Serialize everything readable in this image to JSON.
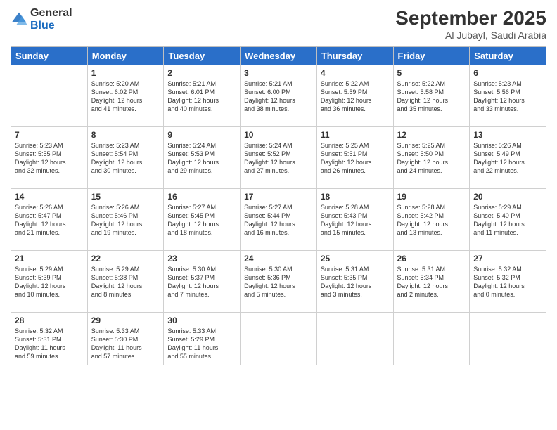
{
  "header": {
    "logo_general": "General",
    "logo_blue": "Blue",
    "month_title": "September 2025",
    "location": "Al Jubayl, Saudi Arabia"
  },
  "weekdays": [
    "Sunday",
    "Monday",
    "Tuesday",
    "Wednesday",
    "Thursday",
    "Friday",
    "Saturday"
  ],
  "weeks": [
    [
      {
        "day": "",
        "text": ""
      },
      {
        "day": "1",
        "text": "Sunrise: 5:20 AM\nSunset: 6:02 PM\nDaylight: 12 hours\nand 41 minutes."
      },
      {
        "day": "2",
        "text": "Sunrise: 5:21 AM\nSunset: 6:01 PM\nDaylight: 12 hours\nand 40 minutes."
      },
      {
        "day": "3",
        "text": "Sunrise: 5:21 AM\nSunset: 6:00 PM\nDaylight: 12 hours\nand 38 minutes."
      },
      {
        "day": "4",
        "text": "Sunrise: 5:22 AM\nSunset: 5:59 PM\nDaylight: 12 hours\nand 36 minutes."
      },
      {
        "day": "5",
        "text": "Sunrise: 5:22 AM\nSunset: 5:58 PM\nDaylight: 12 hours\nand 35 minutes."
      },
      {
        "day": "6",
        "text": "Sunrise: 5:23 AM\nSunset: 5:56 PM\nDaylight: 12 hours\nand 33 minutes."
      }
    ],
    [
      {
        "day": "7",
        "text": "Sunrise: 5:23 AM\nSunset: 5:55 PM\nDaylight: 12 hours\nand 32 minutes."
      },
      {
        "day": "8",
        "text": "Sunrise: 5:23 AM\nSunset: 5:54 PM\nDaylight: 12 hours\nand 30 minutes."
      },
      {
        "day": "9",
        "text": "Sunrise: 5:24 AM\nSunset: 5:53 PM\nDaylight: 12 hours\nand 29 minutes."
      },
      {
        "day": "10",
        "text": "Sunrise: 5:24 AM\nSunset: 5:52 PM\nDaylight: 12 hours\nand 27 minutes."
      },
      {
        "day": "11",
        "text": "Sunrise: 5:25 AM\nSunset: 5:51 PM\nDaylight: 12 hours\nand 26 minutes."
      },
      {
        "day": "12",
        "text": "Sunrise: 5:25 AM\nSunset: 5:50 PM\nDaylight: 12 hours\nand 24 minutes."
      },
      {
        "day": "13",
        "text": "Sunrise: 5:26 AM\nSunset: 5:49 PM\nDaylight: 12 hours\nand 22 minutes."
      }
    ],
    [
      {
        "day": "14",
        "text": "Sunrise: 5:26 AM\nSunset: 5:47 PM\nDaylight: 12 hours\nand 21 minutes."
      },
      {
        "day": "15",
        "text": "Sunrise: 5:26 AM\nSunset: 5:46 PM\nDaylight: 12 hours\nand 19 minutes."
      },
      {
        "day": "16",
        "text": "Sunrise: 5:27 AM\nSunset: 5:45 PM\nDaylight: 12 hours\nand 18 minutes."
      },
      {
        "day": "17",
        "text": "Sunrise: 5:27 AM\nSunset: 5:44 PM\nDaylight: 12 hours\nand 16 minutes."
      },
      {
        "day": "18",
        "text": "Sunrise: 5:28 AM\nSunset: 5:43 PM\nDaylight: 12 hours\nand 15 minutes."
      },
      {
        "day": "19",
        "text": "Sunrise: 5:28 AM\nSunset: 5:42 PM\nDaylight: 12 hours\nand 13 minutes."
      },
      {
        "day": "20",
        "text": "Sunrise: 5:29 AM\nSunset: 5:40 PM\nDaylight: 12 hours\nand 11 minutes."
      }
    ],
    [
      {
        "day": "21",
        "text": "Sunrise: 5:29 AM\nSunset: 5:39 PM\nDaylight: 12 hours\nand 10 minutes."
      },
      {
        "day": "22",
        "text": "Sunrise: 5:29 AM\nSunset: 5:38 PM\nDaylight: 12 hours\nand 8 minutes."
      },
      {
        "day": "23",
        "text": "Sunrise: 5:30 AM\nSunset: 5:37 PM\nDaylight: 12 hours\nand 7 minutes."
      },
      {
        "day": "24",
        "text": "Sunrise: 5:30 AM\nSunset: 5:36 PM\nDaylight: 12 hours\nand 5 minutes."
      },
      {
        "day": "25",
        "text": "Sunrise: 5:31 AM\nSunset: 5:35 PM\nDaylight: 12 hours\nand 3 minutes."
      },
      {
        "day": "26",
        "text": "Sunrise: 5:31 AM\nSunset: 5:34 PM\nDaylight: 12 hours\nand 2 minutes."
      },
      {
        "day": "27",
        "text": "Sunrise: 5:32 AM\nSunset: 5:32 PM\nDaylight: 12 hours\nand 0 minutes."
      }
    ],
    [
      {
        "day": "28",
        "text": "Sunrise: 5:32 AM\nSunset: 5:31 PM\nDaylight: 11 hours\nand 59 minutes."
      },
      {
        "day": "29",
        "text": "Sunrise: 5:33 AM\nSunset: 5:30 PM\nDaylight: 11 hours\nand 57 minutes."
      },
      {
        "day": "30",
        "text": "Sunrise: 5:33 AM\nSunset: 5:29 PM\nDaylight: 11 hours\nand 55 minutes."
      },
      {
        "day": "",
        "text": ""
      },
      {
        "day": "",
        "text": ""
      },
      {
        "day": "",
        "text": ""
      },
      {
        "day": "",
        "text": ""
      }
    ]
  ]
}
